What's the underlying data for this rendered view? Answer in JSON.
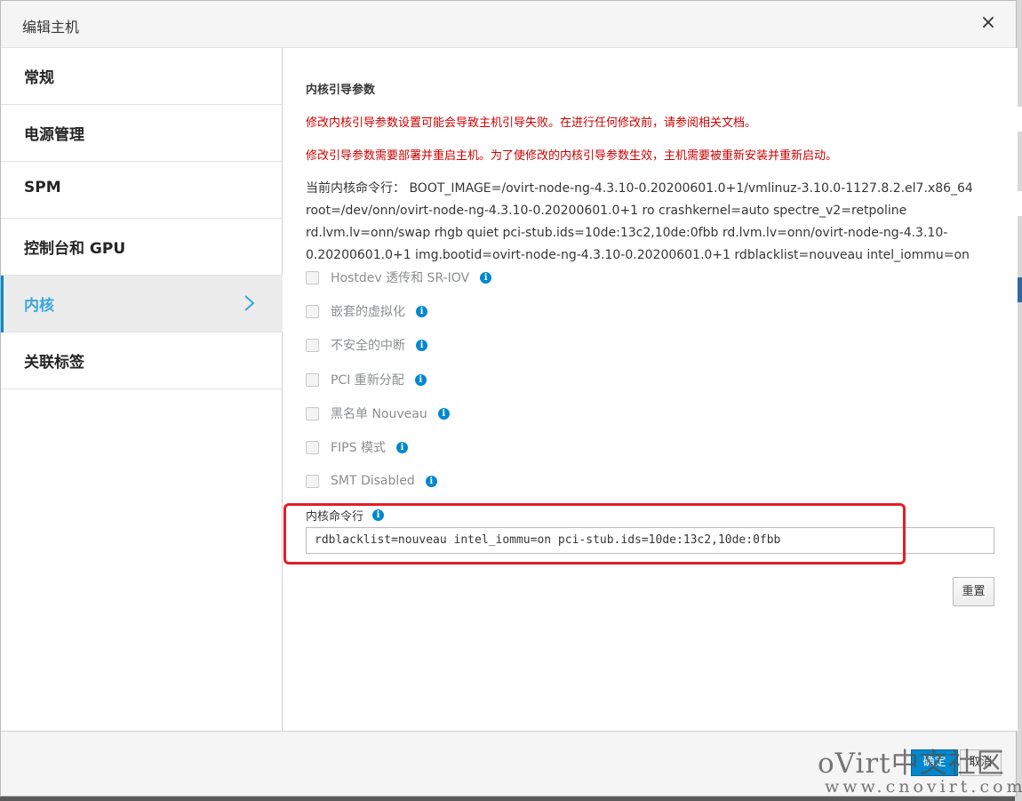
{
  "dialog": {
    "title": "编辑主机",
    "close_glyph": "×"
  },
  "sidebar": {
    "items": [
      {
        "label": "常规"
      },
      {
        "label": "电源管理"
      },
      {
        "label": "SPM"
      },
      {
        "label": "控制台和 GPU"
      },
      {
        "label": "内核",
        "active": true
      },
      {
        "label": "关联标签"
      }
    ]
  },
  "kernel": {
    "section_title": "内核引导参数",
    "warning_1": "修改内核引导参数设置可能会导致主机引导失败。在进行任何修改前，请参阅相关文档。",
    "warning_2": "修改引导参数需要部署并重启主机。为了使修改的内核引导参数生效，主机需要被重新安装并重新启动。",
    "current_cmdline_lines": [
      "当前内核命令行： BOOT_IMAGE=/ovirt-node-ng-4.3.10-0.20200601.0+1/vmlinuz-3.10.0-1127.8.2.el7.x86_64",
      "root=/dev/onn/ovirt-node-ng-4.3.10-0.20200601.0+1 ro crashkernel=auto spectre_v2=retpoline",
      "rd.lvm.lv=onn/swap rhgb quiet pci-stub.ids=10de:13c2,10de:0fbb rd.lvm.lv=onn/ovirt-node-ng-4.3.10-",
      "0.20200601.0+1 img.bootid=ovirt-node-ng-4.3.10-0.20200601.0+1 rdblacklist=nouveau intel_iommu=on"
    ],
    "options": [
      {
        "label": "Hostdev 透传和 SR-IOV",
        "checked": false
      },
      {
        "label": "嵌套的虚拟化",
        "checked": false
      },
      {
        "label": "不安全的中断",
        "checked": false
      },
      {
        "label": "PCI 重新分配",
        "checked": false
      },
      {
        "label": "黑名单 Nouveau",
        "checked": false
      },
      {
        "label": "FIPS 模式",
        "checked": false
      },
      {
        "label": "SMT Disabled",
        "checked": false
      }
    ],
    "info_glyph": "i",
    "cmdline_label": "内核命令行",
    "cmdline_value": "rdblacklist=nouveau intel_iommu=on pci-stub.ids=10de:13c2,10de:0fbb",
    "reset_label": "重置"
  },
  "footer": {
    "ok_label": "确定",
    "cancel_label": "取消"
  },
  "watermark": {
    "main": "oVirt中文社区",
    "url": "www.cnovirt.com"
  },
  "colors": {
    "accent": "#0088ce",
    "active_text": "#39a5dc",
    "warning": "#cc0000",
    "highlight": "#e41e26"
  },
  "icons": {
    "close": "close-icon",
    "chevron": "chevron-right-icon",
    "info": "info-icon"
  }
}
